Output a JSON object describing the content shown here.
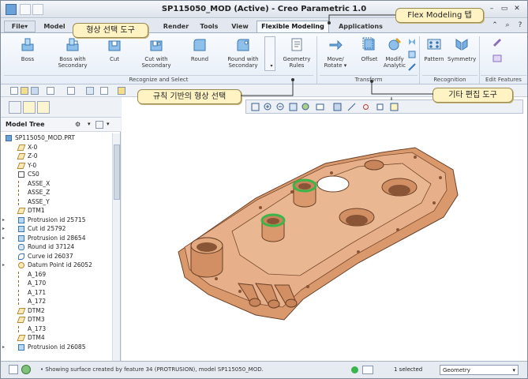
{
  "window": {
    "title": "SP115050_MOD (Active) - Creo Parametric 1.0"
  },
  "menu_tabs": [
    "File",
    "Model",
    "",
    "",
    "Render",
    "Tools",
    "View",
    "Flexible Modeling",
    "Applications"
  ],
  "ribbon": {
    "recognize_select": {
      "label": "Recognize and Select",
      "buttons": [
        "Boss",
        "Boss with Secondary",
        "Cut",
        "Cut with Secondary",
        "Round",
        "Round with Secondary",
        "Geometry Rules"
      ]
    },
    "transform": {
      "label": "Transform",
      "buttons": [
        "Move/ Rotate",
        "Offset",
        "Modify Analytic"
      ]
    },
    "recognition": {
      "label": "Recognition",
      "buttons": [
        "Pattern",
        "Symmetry"
      ]
    },
    "edit_features": {
      "label": "Edit Features"
    }
  },
  "model_tree": {
    "header": "Model Tree",
    "root": "SP115050_MOD.PRT",
    "items": [
      {
        "label": "X-0",
        "type": "plane"
      },
      {
        "label": "Z-0",
        "type": "plane"
      },
      {
        "label": "Y-0",
        "type": "plane"
      },
      {
        "label": "CS0",
        "type": "csys"
      },
      {
        "label": "ASSE_X",
        "type": "axis"
      },
      {
        "label": "ASSE_Z",
        "type": "axis"
      },
      {
        "label": "ASSE_Y",
        "type": "axis"
      },
      {
        "label": "DTM1",
        "type": "plane"
      },
      {
        "label": "Protrusion id 25715",
        "type": "feature",
        "expand": true
      },
      {
        "label": "Cut id 25792",
        "type": "feature",
        "expand": true
      },
      {
        "label": "Protrusion id 28654",
        "type": "feature",
        "expand": true
      },
      {
        "label": "Round id 37124",
        "type": "round"
      },
      {
        "label": "Curve id 26037",
        "type": "curve"
      },
      {
        "label": "Datum Point id 26052",
        "type": "point",
        "expand": true
      },
      {
        "label": "A_169",
        "type": "axis"
      },
      {
        "label": "A_170",
        "type": "axis"
      },
      {
        "label": "A_171",
        "type": "axis"
      },
      {
        "label": "A_172",
        "type": "axis"
      },
      {
        "label": "DTM2",
        "type": "plane"
      },
      {
        "label": "DTM3",
        "type": "plane"
      },
      {
        "label": "A_173",
        "type": "axis"
      },
      {
        "label": "DTM4",
        "type": "plane"
      },
      {
        "label": "Protrusion id 26085",
        "type": "feature",
        "expand": true
      }
    ]
  },
  "status_bar": {
    "message": "• Showing surface created by feature 34 (PROTRUSION), model SP115050_MOD.",
    "selection": "1 selected",
    "filter": "Geometry"
  },
  "callouts": {
    "flex_tab": "Flex Modeling 탭",
    "shape_select": "형상 선택 도구",
    "rule_select": "규칙 기반의 형상 선택",
    "other_edit": "기타 편집 도구"
  },
  "colors": {
    "model": "#e2a97e",
    "highlight": "#3bb54a",
    "callout_bg": "#fff3c4"
  }
}
